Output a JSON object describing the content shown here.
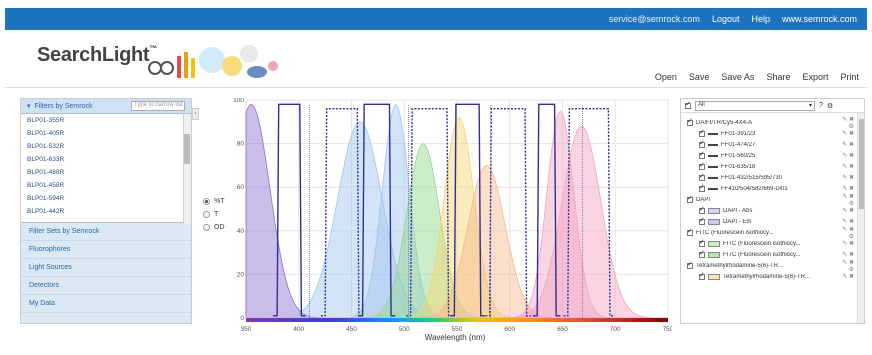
{
  "topbar": {
    "email": "service@semrock.com",
    "logout": "Logout",
    "help": "Help",
    "site": "www.semrock.com"
  },
  "header": {
    "logo_text": "SearchLight",
    "logo_tm": "™"
  },
  "menu": [
    "Open",
    "Save",
    "Save As",
    "Share",
    "Export",
    "Print"
  ],
  "left_panel": {
    "filters_header": "Filters by Semrock",
    "search_placeholder": "Type to narrow list",
    "filters": [
      "BLP01-355R",
      "BLP01-405R",
      "BLP01-532R",
      "BLP01-633R",
      "BLP01-488R",
      "BLP01-458R",
      "BLP01-594R",
      "BLP01-442R"
    ],
    "sections": [
      "Filter Sets by Semrock",
      "Fluorophores",
      "Light Sources",
      "Detectors",
      "My Data"
    ],
    "collapse": "‹"
  },
  "display_mode": {
    "options": [
      "%T",
      "T",
      "OD"
    ],
    "selected": "%T"
  },
  "right_panel": {
    "select_label": "All",
    "rows": [
      {
        "type": "group",
        "label": "DA/FI/TR/Cy5-4X4-A"
      },
      {
        "type": "line",
        "label": "FF01-391/23"
      },
      {
        "type": "line",
        "label": "FF01-474/27"
      },
      {
        "type": "line",
        "label": "FF01-560/25"
      },
      {
        "type": "line",
        "label": "FF01-635/18"
      },
      {
        "type": "line",
        "label": "FF01-432/515/595/730"
      },
      {
        "type": "line",
        "label": "FF410/504/582/669-Di01"
      },
      {
        "type": "group",
        "label": "DAPI"
      },
      {
        "type": "box",
        "label": "DAPI - Abs",
        "color": "#d7d7f5"
      },
      {
        "type": "box",
        "label": "DAPI - Em",
        "color": "#c7c7ef"
      },
      {
        "type": "group",
        "label": "FITC (Fluorescein isothiocy..."
      },
      {
        "type": "box",
        "label": "FITC (Fluorescein isothiocy...",
        "color": "#c9ecc3"
      },
      {
        "type": "box",
        "label": "FITC (Fluorescein isothiocy...",
        "color": "#b9e3b0"
      },
      {
        "type": "group",
        "label": "Tetramethylrhodamine-5(6)-TR..."
      },
      {
        "type": "box",
        "label": "Tetramethylrhodamine-5(6)-TR...",
        "color": "#fbe7a8"
      }
    ]
  },
  "chart_data": {
    "type": "line",
    "xlabel": "Wavelength (nm)",
    "ylabel": "",
    "xlim": [
      350,
      750
    ],
    "ylim": [
      0,
      100
    ],
    "xticks": [
      350,
      400,
      450,
      500,
      550,
      600,
      650,
      700,
      750
    ],
    "yticks": [
      0,
      20,
      40,
      60,
      80,
      100
    ],
    "colors": {
      "violet": "#8e6fd0",
      "blue": "#9fc4ef",
      "green": "#8fd68a",
      "yellow": "#f3d56b",
      "orange": "#f6b98a",
      "pink": "#f2a1c3",
      "filter": "#2f2f8f"
    },
    "bandpass": [
      {
        "name": "FF01-391/23",
        "start": 379.5,
        "end": 402.5,
        "peak": 98
      },
      {
        "name": "FF01-474/27",
        "start": 460.5,
        "end": 487.5,
        "peak": 98
      },
      {
        "name": "FF01-560/25",
        "start": 547.5,
        "end": 572.5,
        "peak": 98
      },
      {
        "name": "FF01-635/18",
        "start": 626,
        "end": 644,
        "peak": 98
      }
    ],
    "emitter_bands": [
      {
        "start": 425,
        "end": 457,
        "peak": 96
      },
      {
        "start": 506,
        "end": 542,
        "peak": 96
      },
      {
        "start": 581,
        "end": 616,
        "peak": 96
      },
      {
        "start": 655,
        "end": 695,
        "peak": 96
      }
    ],
    "dichroic_edges": [
      410,
      504,
      582,
      669
    ]
  }
}
